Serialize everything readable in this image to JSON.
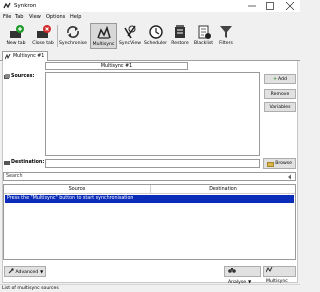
{
  "window": {
    "title": "Synkron"
  },
  "menu": [
    {
      "label": "File"
    },
    {
      "label": "Tab"
    },
    {
      "label": "View"
    },
    {
      "label": "Options"
    },
    {
      "label": "Help"
    }
  ],
  "toolbar": {
    "new_tab": "New tab",
    "close_tab": "Close tab",
    "synchronise": "Synchronise",
    "multisync": "Multisync",
    "syncview": "SyncView",
    "scheduler": "Scheduler",
    "restore": "Restore",
    "blacklist": "Blacklist",
    "filters": "Filters"
  },
  "tab": {
    "label": "Multisync #1"
  },
  "multisync": {
    "name_value": "Multisync #1",
    "sources_label": "Sources:",
    "destination_label": "Destination:",
    "destination_value": "",
    "add_label": "Add",
    "remove_label": "Remove",
    "variables_label": "Variables",
    "browse_label": "Browse"
  },
  "search": {
    "placeholder": "Search"
  },
  "grid": {
    "columns": [
      "Source",
      "Destination"
    ],
    "rows": [
      "Press the \"Multisync\" button to start synchronisation"
    ]
  },
  "footer": {
    "advanced_label": "Advanced",
    "analyse_label": "Analyse",
    "multisync_label": "Multisync"
  },
  "status": {
    "text": "List of multisync sources"
  },
  "colors": {
    "selection": "#0a2cb8",
    "add_icon": "#2a8a2a"
  }
}
